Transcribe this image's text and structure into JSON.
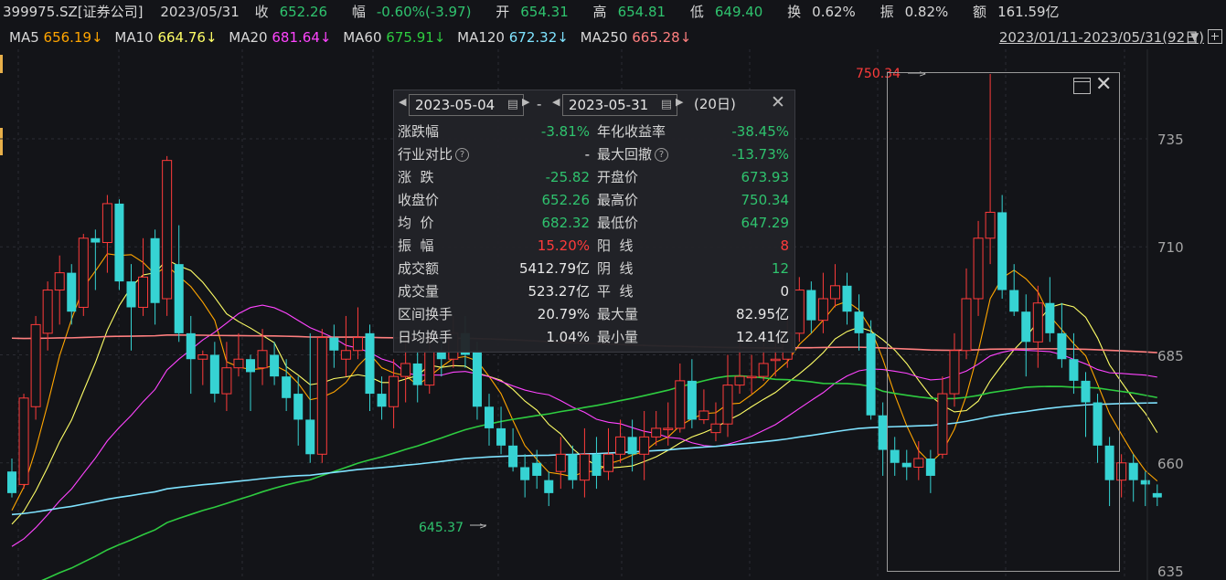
{
  "header": {
    "code": "399975.SZ[证券公司]",
    "date": "2023/05/31",
    "close_label": "收",
    "close": "652.26",
    "change_label": "幅",
    "change": "-0.60%(-3.97)",
    "open_label": "开",
    "open": "654.31",
    "high_label": "高",
    "high": "654.81",
    "low_label": "低",
    "low": "649.40",
    "turnover_label": "换",
    "turnover": "0.62%",
    "amplitude_label": "振",
    "amplitude": "0.82%",
    "amount_label": "额",
    "amount": "161.59亿"
  },
  "ma_bar": {
    "items": [
      {
        "name": "MA5",
        "value": "656.19↓",
        "color": "#ffa500"
      },
      {
        "name": "MA10",
        "value": "664.76↓",
        "color": "#ffff66"
      },
      {
        "name": "MA20",
        "value": "681.64↓",
        "color": "#ff44ff"
      },
      {
        "name": "MA60",
        "value": "675.91↓",
        "color": "#2ecc40"
      },
      {
        "name": "MA120",
        "value": "672.32↓",
        "color": "#7fe3ff"
      },
      {
        "name": "MA250",
        "value": "665.28↓",
        "color": "#ff7f7f"
      }
    ],
    "range": "2023/01/11-2023/05/31(92日)"
  },
  "yaxis": [
    "735",
    "710",
    "685",
    "660",
    "635"
  ],
  "annotations": {
    "max_label": "750.34",
    "min_label": "645.37"
  },
  "popup": {
    "start_date": "2023-05-04",
    "end_date": "2023-05-31",
    "sep": "-",
    "days": "(20日)",
    "rows_left": [
      {
        "k": "涨跌幅",
        "v": "-3.81%",
        "c": "green"
      },
      {
        "k": "行业对比",
        "v": "-",
        "c": "white",
        "q": true
      },
      {
        "k": "涨  跌",
        "v": "-25.82",
        "c": "green"
      },
      {
        "k": "收盘价",
        "v": "652.26",
        "c": "green"
      },
      {
        "k": "均  价",
        "v": "682.32",
        "c": "green"
      },
      {
        "k": "振  幅",
        "v": "15.20%",
        "c": "red"
      },
      {
        "k": "成交额",
        "v": "5412.79亿",
        "c": "white"
      },
      {
        "k": "成交量",
        "v": "523.27亿",
        "c": "white"
      },
      {
        "k": "区间换手",
        "v": "20.79%",
        "c": "white"
      },
      {
        "k": "日均换手",
        "v": "1.04%",
        "c": "white"
      }
    ],
    "rows_right": [
      {
        "k": "年化收益率",
        "v": "-38.45%",
        "c": "green"
      },
      {
        "k": "最大回撤",
        "v": "-13.73%",
        "c": "green",
        "q": true
      },
      {
        "k": "开盘价",
        "v": "673.93",
        "c": "green"
      },
      {
        "k": "最高价",
        "v": "750.34",
        "c": "green"
      },
      {
        "k": "最低价",
        "v": "647.29",
        "c": "green"
      },
      {
        "k": "阳  线",
        "v": "8",
        "c": "red"
      },
      {
        "k": "阴  线",
        "v": "12",
        "c": "green"
      },
      {
        "k": "平  线",
        "v": "0",
        "c": "white"
      },
      {
        "k": "最大量",
        "v": "82.95亿",
        "c": "white"
      },
      {
        "k": "最小量",
        "v": "12.41亿",
        "c": "white"
      }
    ]
  },
  "colors": {
    "up": "#ff3b3b",
    "down": "#36d3d3",
    "green_text": "#2fc36e",
    "red_text": "#ff3b3b"
  },
  "chart_data": {
    "type": "candlestick",
    "ylim": [
      635,
      750
    ],
    "candles": [
      [
        658,
        653,
        661,
        652
      ],
      [
        655,
        675,
        676,
        654
      ],
      [
        673,
        692,
        694,
        670
      ],
      [
        690,
        700,
        702,
        686
      ],
      [
        700,
        704,
        708,
        692
      ],
      [
        704,
        695,
        706,
        692
      ],
      [
        696,
        712,
        713,
        694
      ],
      [
        712,
        711,
        714,
        700
      ],
      [
        711,
        720,
        722,
        704
      ],
      [
        720,
        702,
        721,
        700
      ],
      [
        702,
        696,
        706,
        686
      ],
      [
        696,
        703,
        712,
        694
      ],
      [
        712,
        697,
        714,
        692
      ],
      [
        698,
        730,
        731,
        694
      ],
      [
        706,
        690,
        715,
        688
      ],
      [
        690,
        684,
        694,
        676
      ],
      [
        684,
        685,
        686,
        678
      ],
      [
        685,
        676,
        688,
        674
      ],
      [
        676,
        682,
        688,
        672
      ],
      [
        682,
        684,
        690,
        680
      ],
      [
        684,
        681,
        685,
        672
      ],
      [
        682,
        686,
        691,
        678
      ],
      [
        685,
        680,
        688,
        678
      ],
      [
        680,
        675,
        684,
        672
      ],
      [
        676,
        670,
        680,
        664
      ],
      [
        670,
        662,
        690,
        660
      ],
      [
        662,
        689,
        691,
        660
      ],
      [
        689,
        686,
        692,
        682
      ],
      [
        684,
        686,
        694,
        680
      ],
      [
        686,
        689,
        696,
        684
      ],
      [
        690,
        676,
        692,
        672
      ],
      [
        676,
        673,
        680,
        670
      ],
      [
        673,
        680,
        684,
        668
      ],
      [
        680,
        683,
        690,
        674
      ],
      [
        683,
        678,
        686,
        674
      ],
      [
        678,
        686,
        690,
        676
      ],
      [
        686,
        684,
        690,
        680
      ],
      [
        684,
        690,
        694,
        682
      ],
      [
        690,
        685,
        694,
        682
      ],
      [
        686,
        673,
        688,
        670
      ],
      [
        673,
        668,
        676,
        664
      ],
      [
        668,
        664,
        673,
        662
      ],
      [
        664,
        659,
        668,
        658
      ],
      [
        659,
        656,
        662,
        652
      ],
      [
        660,
        657,
        663,
        654
      ],
      [
        656,
        653,
        658,
        650
      ],
      [
        658,
        662,
        666,
        654
      ],
      [
        662,
        656,
        664,
        654
      ],
      [
        656,
        662,
        668,
        652
      ],
      [
        662,
        657,
        666,
        654
      ],
      [
        658,
        662,
        668,
        656
      ],
      [
        662,
        666,
        670,
        660
      ],
      [
        666,
        662,
        670,
        658
      ],
      [
        662,
        666,
        672,
        656
      ],
      [
        666,
        668,
        672,
        664
      ],
      [
        668,
        668,
        674,
        664
      ],
      [
        668,
        679,
        683,
        667
      ],
      [
        679,
        670,
        684,
        668
      ],
      [
        670,
        672,
        677,
        669
      ],
      [
        667,
        669,
        674,
        665
      ],
      [
        669,
        678,
        685,
        666
      ],
      [
        678,
        680,
        688,
        676
      ],
      [
        680,
        680,
        685,
        676
      ],
      [
        680,
        683,
        689,
        679
      ],
      [
        684,
        684,
        688,
        680
      ],
      [
        684,
        690,
        694,
        682
      ],
      [
        690,
        700,
        703,
        688
      ],
      [
        700,
        693,
        702,
        690
      ],
      [
        693,
        698,
        704,
        690
      ],
      [
        698,
        701,
        706,
        696
      ],
      [
        701,
        695,
        704,
        692
      ],
      [
        695,
        690,
        699,
        686
      ],
      [
        690,
        671,
        693,
        670
      ],
      [
        671,
        663,
        674,
        657
      ],
      [
        663,
        660,
        666,
        657
      ],
      [
        660,
        659,
        663,
        656
      ],
      [
        659,
        661,
        665,
        656
      ],
      [
        661,
        657,
        663,
        653
      ],
      [
        662,
        676,
        680,
        661
      ],
      [
        676,
        686,
        690,
        673
      ],
      [
        686,
        698,
        705,
        684
      ],
      [
        698,
        712,
        716,
        694
      ],
      [
        712,
        718,
        750,
        706
      ],
      [
        718,
        700,
        722,
        698
      ],
      [
        700,
        695,
        706,
        694
      ],
      [
        695,
        688,
        699,
        680
      ],
      [
        688,
        697,
        701,
        682
      ],
      [
        697,
        690,
        703,
        688
      ],
      [
        690,
        684,
        697,
        682
      ],
      [
        684,
        679,
        690,
        676
      ],
      [
        679,
        674,
        681,
        666
      ],
      [
        674,
        664,
        676,
        660
      ],
      [
        664,
        656,
        666,
        650
      ],
      [
        656,
        660,
        662,
        652
      ],
      [
        660,
        656,
        662,
        651
      ],
      [
        656,
        655,
        658,
        650
      ],
      [
        653,
        652,
        655,
        650
      ]
    ]
  }
}
